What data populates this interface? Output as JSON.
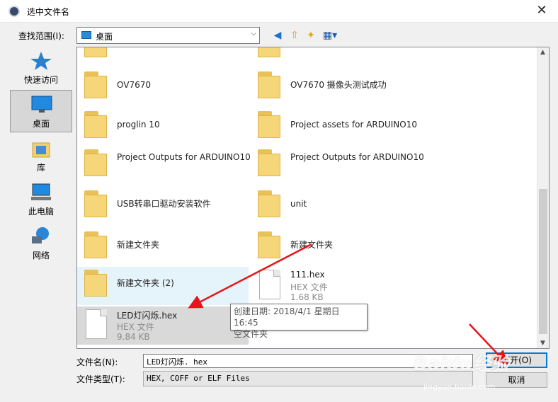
{
  "window": {
    "title": "选中文件名",
    "close_glyph": "✕"
  },
  "toolbar": {
    "look_in_label": "查找范围(I):",
    "look_in_value": "桌面",
    "back_glyph": "◀",
    "up_glyph": "⇧",
    "newfolder_glyph": "✦",
    "view_glyph": "▦▾",
    "combo_arrow": "⌵"
  },
  "places": [
    {
      "label": "快速访问",
      "icon": "star-icon"
    },
    {
      "label": "桌面",
      "icon": "desktop-icon"
    },
    {
      "label": "库",
      "icon": "library-icon"
    },
    {
      "label": "此电脑",
      "icon": "computer-icon"
    },
    {
      "label": "网络",
      "icon": "network-icon"
    }
  ],
  "items": [
    {
      "name": "OV7670"
    },
    {
      "name": "OV7670 摄像头测试成功"
    },
    {
      "name": "proglin 10"
    },
    {
      "name": "Project assets for ARDUINO10"
    },
    {
      "name": "Project Outputs for ARDUINO10"
    },
    {
      "name": "Project Outputs for ARDUINO10"
    },
    {
      "name": "USB转串口驱动安装软件"
    },
    {
      "name": "unit"
    },
    {
      "name": "新建文件夹"
    },
    {
      "name": "新建文件夹"
    },
    {
      "name": "新建文件夹 (2)"
    },
    {
      "name": "111.hex",
      "type": "HEX 文件",
      "size": "1.68 KB"
    },
    {
      "name": "LED灯闪烁.hex",
      "type": "HEX 文件",
      "size": "9.84 KB"
    }
  ],
  "tooltip": {
    "line1": "创建日期: 2018/4/1 星期日 16:45",
    "line2": "空文件夹"
  },
  "filename": {
    "label": "文件名(N):",
    "value": "LED灯闪烁. hex"
  },
  "filetype": {
    "label": "文件类型(T):",
    "value": "HEX, COFF or ELF Files"
  },
  "buttons": {
    "open": "打开(O)",
    "cancel": "取消"
  },
  "scrollbar": {
    "up": "▲",
    "down": "▼"
  },
  "watermark": {
    "logo": "Baidu经验",
    "url": "jingyan.baidu.com"
  },
  "colors": {
    "accent": "#0078d7",
    "annotation": "#e8141c",
    "folder": "#f5d679"
  }
}
